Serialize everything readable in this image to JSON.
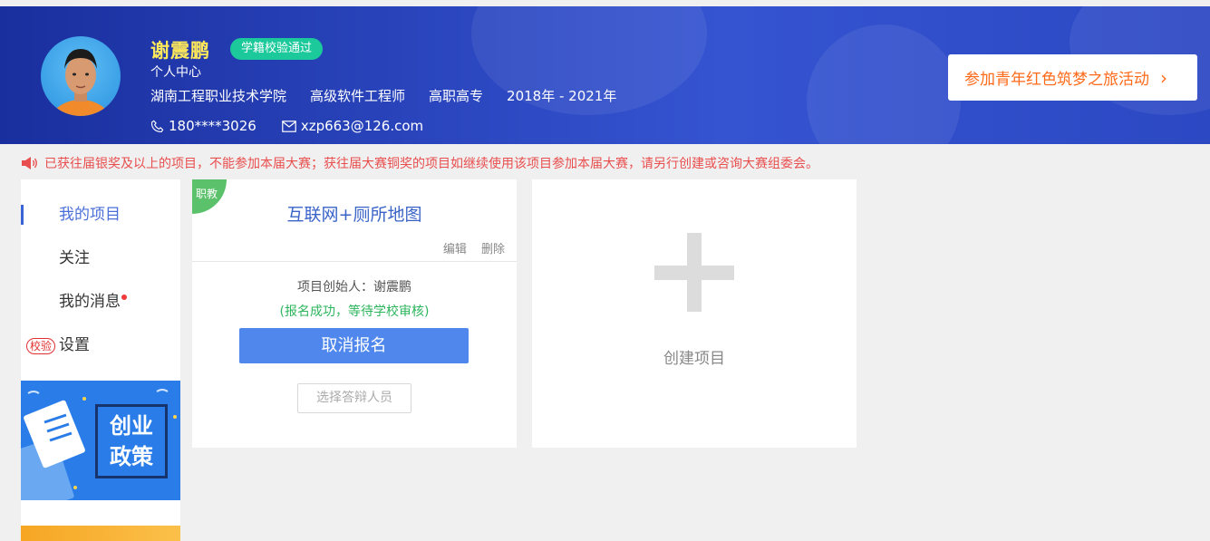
{
  "profile": {
    "name": "谢震鹏",
    "badge": "学籍校验通过",
    "subtitle": "个人中心",
    "school": "湖南工程职业技术学院",
    "major": "高级软件工程师",
    "level": "高职高专",
    "period": "2018年 - 2021年",
    "phone": "180****3026",
    "email": "xzp663@126.com"
  },
  "activity_button": {
    "label": "参加青年红色筑梦之旅活动",
    "chevron": "›"
  },
  "notice": {
    "text": "已获往届银奖及以上的项目，不能参加本届大赛；获往届大赛铜奖的项目如继续使用该项目参加本届大赛，请另行创建或咨询大赛组委会。"
  },
  "sidebar": {
    "items": [
      {
        "label": "我的项目"
      },
      {
        "label": "关注"
      },
      {
        "label": "我的消息"
      },
      {
        "label": "设置",
        "tag": "校验"
      }
    ],
    "banner": {
      "line1": "创业",
      "line2": "政策"
    }
  },
  "project": {
    "corner_tag": "职教",
    "title": "互联网+厕所地图",
    "edit": "编辑",
    "delete": "删除",
    "creator": "项目创始人：谢震鹏",
    "status": "(报名成功，等待学校审核)",
    "cancel": "取消报名",
    "choose": "选择答辩人员"
  },
  "create": {
    "label": "创建项目"
  },
  "colors": {
    "accent": "#4f87ec",
    "header": "#2a45bd",
    "success": "#2db55d",
    "warning": "#e94e4e",
    "orange": "#ff6a1a"
  }
}
